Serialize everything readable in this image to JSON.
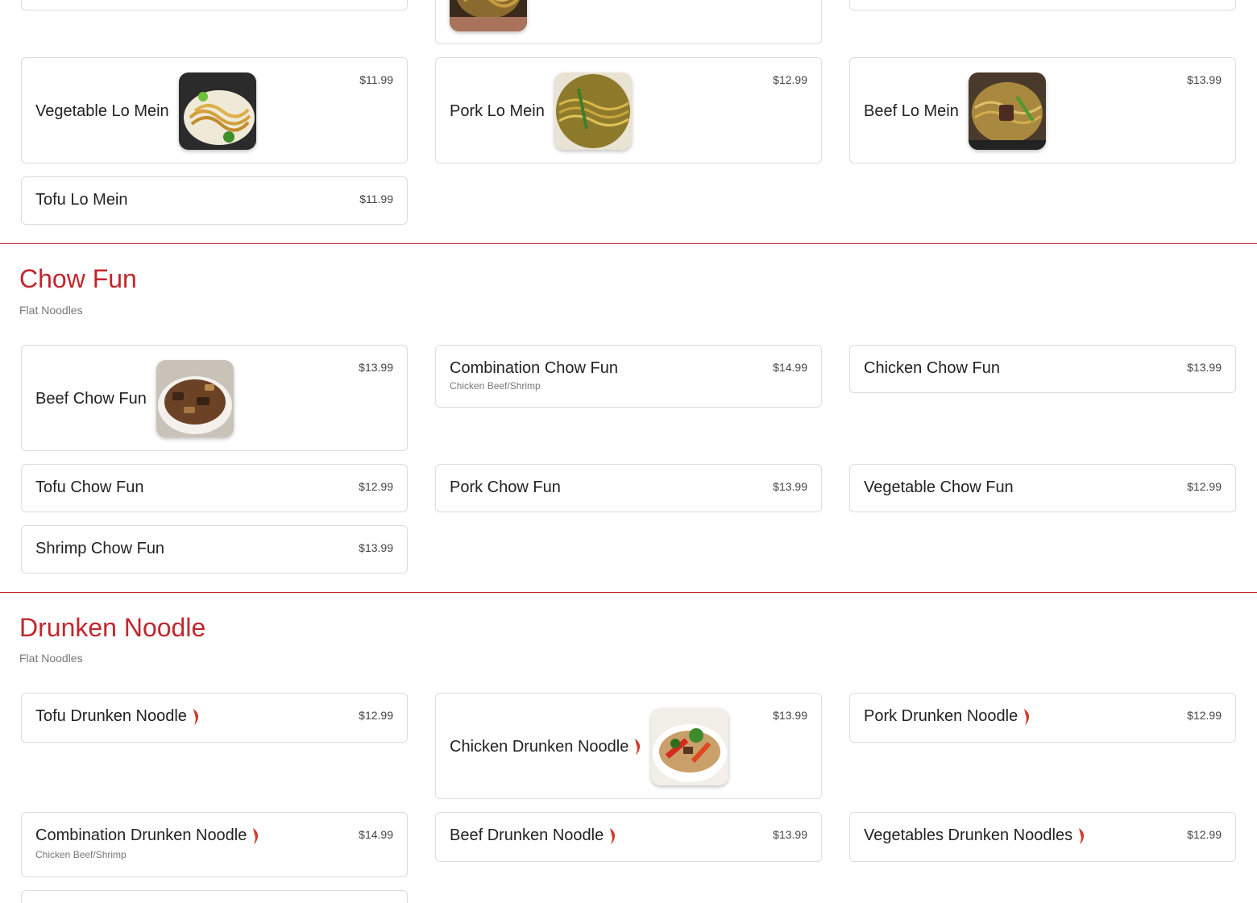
{
  "colors": {
    "accent": "#c0272d",
    "card_border": "#dcdcdc"
  },
  "lo_mein": {
    "items": [
      {
        "name": "Vegetable Lo Mein",
        "price": "$11.99"
      },
      {
        "name": "Pork Lo Mein",
        "price": "$12.99"
      },
      {
        "name": "Beef Lo Mein",
        "price": "$13.99"
      },
      {
        "name": "Tofu Lo Mein",
        "price": "$11.99"
      }
    ]
  },
  "chow_fun": {
    "title": "Chow Fun",
    "subtitle": "Flat Noodles",
    "items": [
      {
        "name": "Beef Chow Fun",
        "price": "$13.99"
      },
      {
        "name": "Combination Chow Fun",
        "price": "$14.99",
        "desc": "Chicken Beef/Shrimp"
      },
      {
        "name": "Chicken Chow Fun",
        "price": "$13.99"
      },
      {
        "name": "Tofu Chow Fun",
        "price": "$12.99"
      },
      {
        "name": "Pork Chow Fun",
        "price": "$13.99"
      },
      {
        "name": "Vegetable Chow Fun",
        "price": "$12.99"
      },
      {
        "name": "Shrimp Chow Fun",
        "price": "$13.99"
      }
    ]
  },
  "drunken_noodle": {
    "title": "Drunken Noodle",
    "subtitle": "Flat Noodles",
    "spicy_icon": "chili-pepper-icon",
    "items": [
      {
        "name": "Tofu Drunken Noodle",
        "price": "$12.99"
      },
      {
        "name": "Chicken Drunken Noodle",
        "price": "$13.99"
      },
      {
        "name": "Pork Drunken Noodle",
        "price": "$12.99"
      },
      {
        "name": "Combination Drunken Noodle",
        "price": "$14.99",
        "desc": "Chicken Beef/Shrimp"
      },
      {
        "name": "Beef Drunken Noodle",
        "price": "$13.99"
      },
      {
        "name": "Vegetables Drunken Noodles",
        "price": "$12.99"
      }
    ]
  }
}
